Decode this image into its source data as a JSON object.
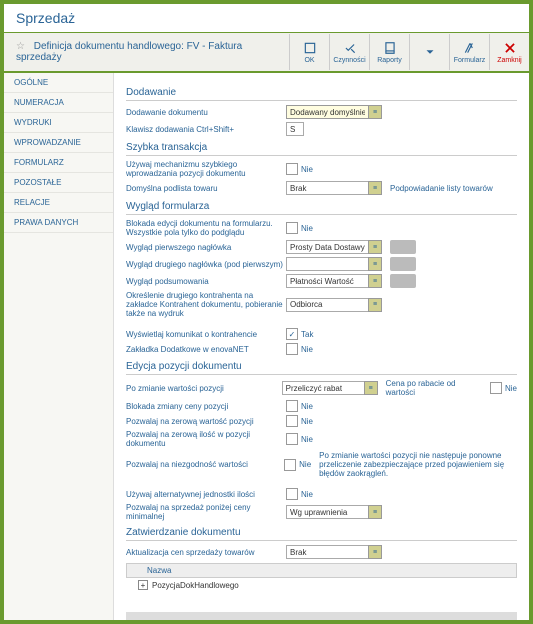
{
  "title": "Sprzedaż",
  "subtitle": "Definicja dokumentu handlowego: FV - Faktura sprzedaży",
  "toolbar": {
    "ok": "OK",
    "czynnosci": "Czynności",
    "raporty": "Raporty",
    "formularz": "Formularz",
    "zamknij": "Zamknij"
  },
  "sidebar": [
    "OGÓLNE",
    "NUMERACJA",
    "WYDRUKI",
    "WPROWADZANIE",
    "FORMULARZ",
    "POZOSTAŁE",
    "RELACJE",
    "PRAWA DANYCH"
  ],
  "sections": {
    "dodawanie": {
      "title": "Dodawanie",
      "r1": "Dodawanie dokumentu",
      "r1v": "Dodawany domyślnie",
      "r2": "Klawisz dodawania Ctrl+Shift+",
      "r2v": "S"
    },
    "szybka": {
      "title": "Szybka transakcja",
      "r1": "Używaj mechanizmu szybkiego wprowadzania pozycji dokumentu",
      "r1n": "Nie",
      "r2": "Domyślna podlista towaru",
      "r2v": "Brak",
      "r2after": "Podpowiadanie listy towarów"
    },
    "wyglad": {
      "title": "Wygląd formularza",
      "r1": "Blokada edycji dokumentu na formularzu. Wszystkie pola tylko do podglądu",
      "r1n": "Nie",
      "r2": "Wygląd pierwszego nagłówka",
      "r2v": "Prosty Data Dostawy",
      "r3": "Wygląd drugiego nagłówka (pod pierwszym)",
      "r4": "Wygląd podsumowania",
      "r4v": "Płatności Wartość",
      "r5": "Określenie drugiego kontrahenta na zakładce Kontrahent dokumentu, pobieranie także na wydruk",
      "r5v": "Odbiorca",
      "r6": "Wyświetlaj komunikat o kontrahencie",
      "r6n": "Tak",
      "r7": "Zakładka Dodatkowe w enovaNET",
      "r7n": "Nie"
    },
    "edycja": {
      "title": "Edycja pozycji dokumentu",
      "r1": "Po zmianie wartości pozycji",
      "r1v": "Przeliczyć rabat",
      "r1after": "Cena po rabacie od wartości",
      "r1aftern": "Nie",
      "r2": "Blokada zmiany ceny pozycji",
      "r2n": "Nie",
      "r3": "Pozwalaj na zerową wartość pozycji",
      "r3n": "Nie",
      "r4": "Pozwalaj na zerową ilość w pozycji dokumentu",
      "r4n": "Nie",
      "r5": "Pozwalaj na niezgodność wartości",
      "r5n": "Nie",
      "r5after": "Po zmianie wartości pozycji nie następuje ponowne przeliczenie zabezpieczające przed pojawieniem się błędów zaokrągleń.",
      "r6": "Używaj alternatywnej jednostki ilości",
      "r6n": "Nie",
      "r7": "Pozwalaj na sprzedaż poniżej ceny minimalnej",
      "r7v": "Wg uprawnienia"
    },
    "zatw": {
      "title": "Zatwierdzanie dokumentu",
      "r1": "Aktualizacja cen sprzedaży towarów",
      "r1v": "Brak",
      "treehead": "Nazwa",
      "treerow": "PozycjaDokHandlowego"
    }
  }
}
